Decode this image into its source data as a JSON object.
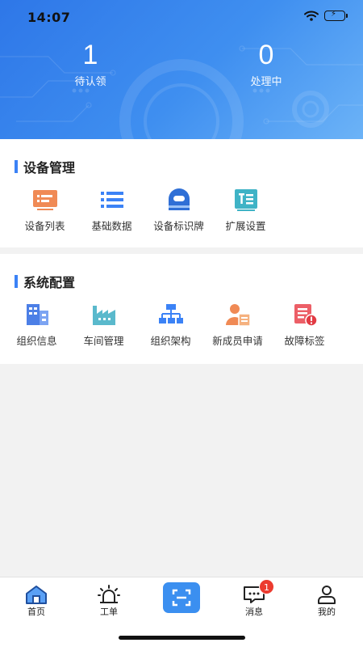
{
  "status_bar": {
    "time": "14:07"
  },
  "stats": [
    {
      "value": "1",
      "label": "待认领"
    },
    {
      "value": "0",
      "label": "处理中"
    }
  ],
  "sections": {
    "device": {
      "title": "设备管理",
      "items": [
        {
          "label": "设备列表",
          "icon": "device-list-icon"
        },
        {
          "label": "基础数据",
          "icon": "basic-data-icon"
        },
        {
          "label": "设备标识牌",
          "icon": "device-tag-icon"
        },
        {
          "label": "扩展设置",
          "icon": "extend-settings-icon"
        }
      ]
    },
    "system": {
      "title": "系统配置",
      "items": [
        {
          "label": "组织信息",
          "icon": "org-info-icon"
        },
        {
          "label": "车间管理",
          "icon": "workshop-icon"
        },
        {
          "label": "组织架构",
          "icon": "org-structure-icon"
        },
        {
          "label": "新成员申请",
          "icon": "member-apply-icon"
        },
        {
          "label": "故障标签",
          "icon": "fault-tag-icon"
        }
      ]
    }
  },
  "tabbar": {
    "items": [
      {
        "label": "首页",
        "icon": "home-icon"
      },
      {
        "label": "工单",
        "icon": "alarm-icon"
      },
      {
        "label": "",
        "icon": "scan-icon"
      },
      {
        "label": "消息",
        "icon": "message-icon",
        "badge": "1"
      },
      {
        "label": "我的",
        "icon": "user-icon"
      }
    ]
  },
  "colors": {
    "header_start": "#2e77e8",
    "header_end": "#6cb3f7",
    "accent": "#3b82f6",
    "badge": "#ec3b2f"
  }
}
